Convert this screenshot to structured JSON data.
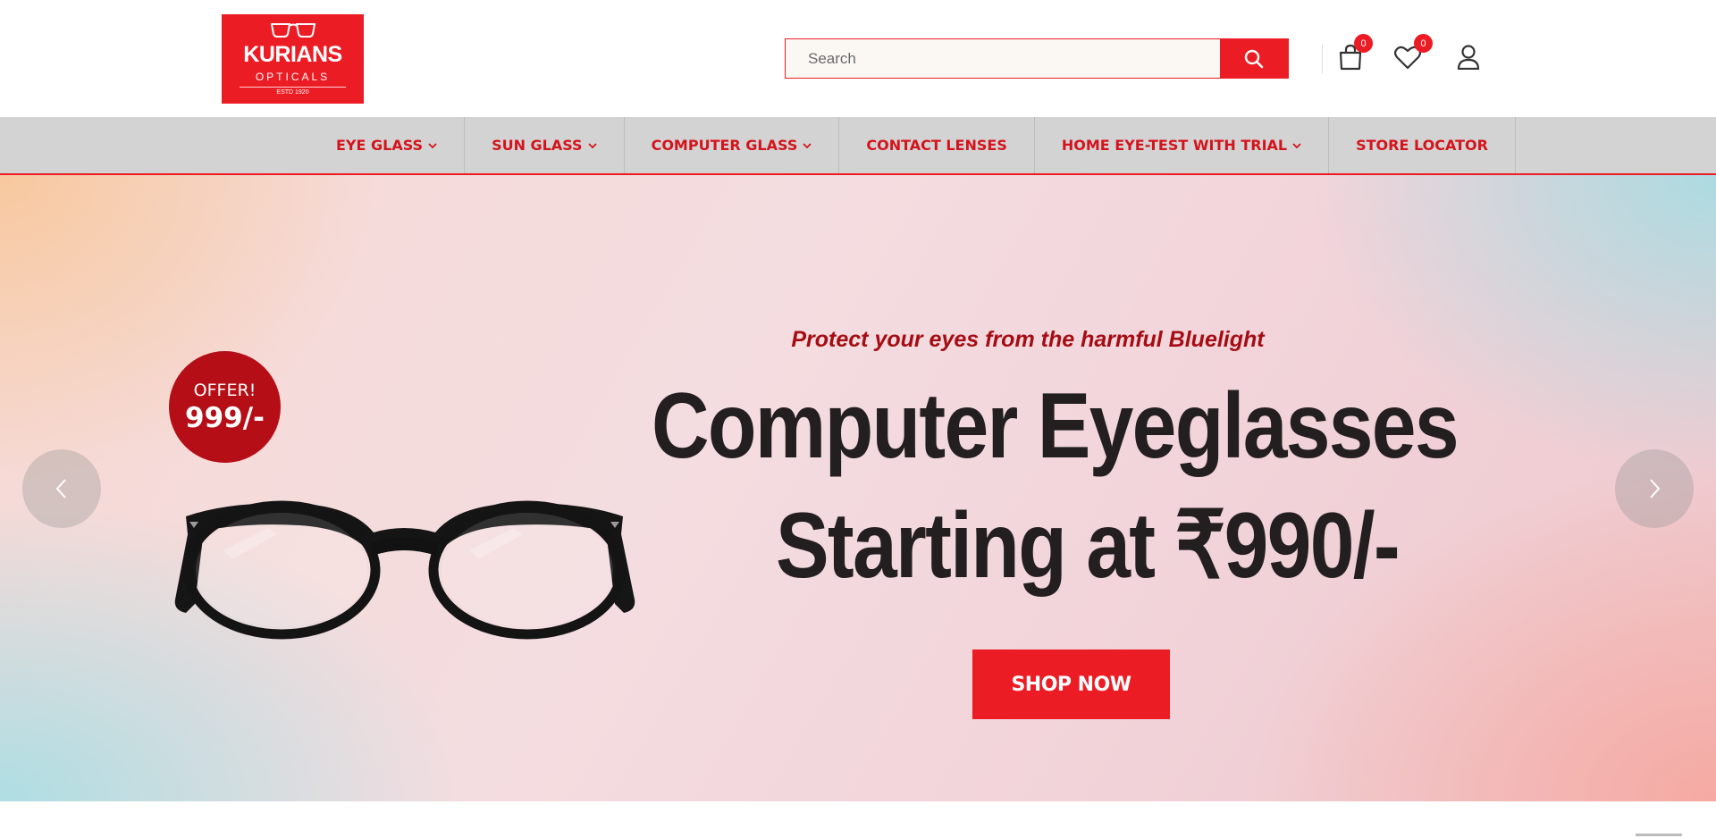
{
  "brand": {
    "name": "KURIANS",
    "sub": "OPTICALS",
    "estd": "ESTD 1920",
    "color": "#ec1c24"
  },
  "search": {
    "placeholder": "Search",
    "value": ""
  },
  "header_icons": {
    "cart_count": "0",
    "wishlist_count": "0"
  },
  "nav": {
    "items": [
      {
        "label": "EYE GLASS",
        "dropdown": true
      },
      {
        "label": "SUN GLASS",
        "dropdown": true
      },
      {
        "label": "COMPUTER GLASS",
        "dropdown": true
      },
      {
        "label": "CONTACT LENSES",
        "dropdown": false
      },
      {
        "label": "HOME EYE-TEST WITH TRIAL",
        "dropdown": true
      },
      {
        "label": "STORE LOCATOR",
        "dropdown": false
      }
    ]
  },
  "hero": {
    "offer_label": "OFFER!",
    "offer_price": "999/-",
    "tagline": "Protect your eyes from the harmful Bluelight",
    "headline_line1": "Computer Eyeglasses",
    "headline_line2": "Starting at ₹990/-",
    "cta": "SHOP NOW"
  }
}
